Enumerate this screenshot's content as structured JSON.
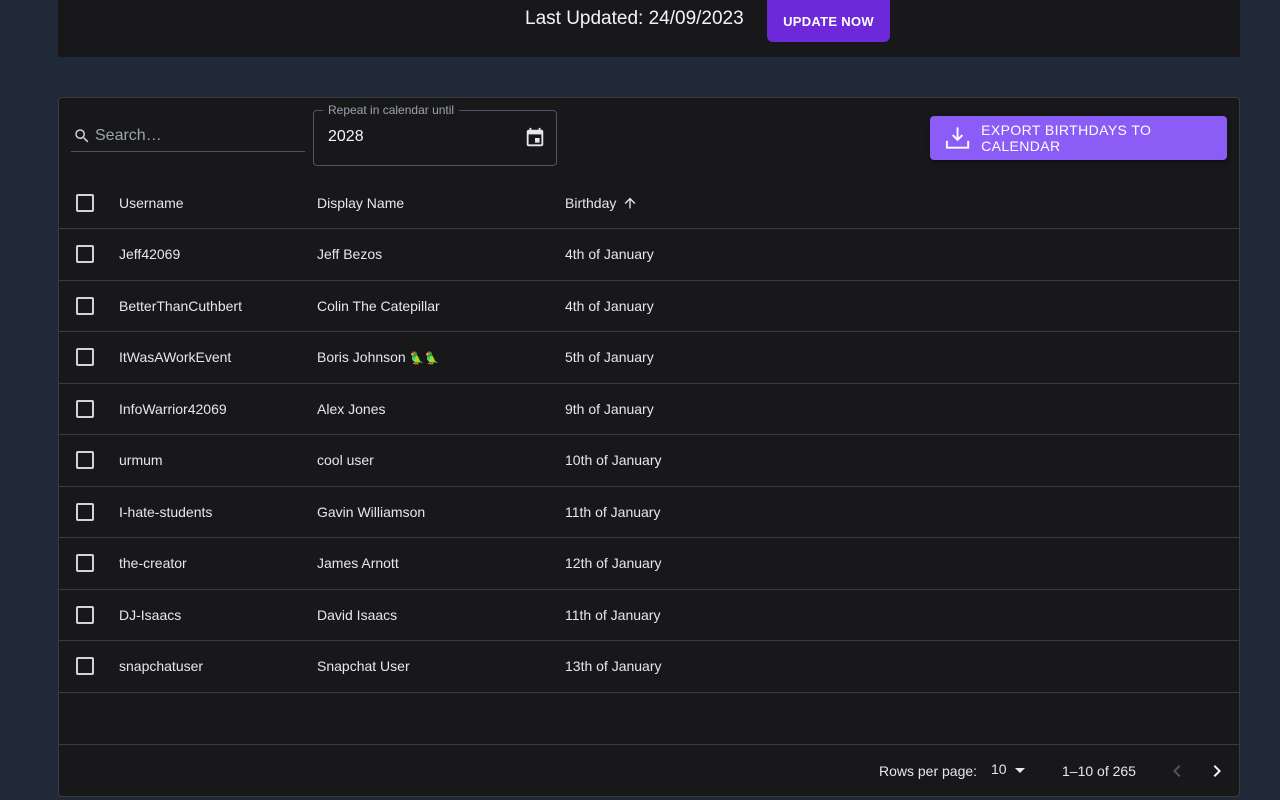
{
  "header": {
    "last_updated": "Last Updated: 24/09/2023",
    "update_button": "UPDATE NOW"
  },
  "toolbar": {
    "search_placeholder": "Search…",
    "repeat_label": "Repeat in calendar until",
    "repeat_value": "2028",
    "export_button": "EXPORT BIRTHDAYS TO CALENDAR"
  },
  "table": {
    "columns": [
      "Username",
      "Display Name",
      "Birthday"
    ],
    "sort": {
      "column": "Birthday",
      "direction": "ascending"
    },
    "rows": [
      {
        "username": "Jeff42069",
        "display_name": "Jeff Bezos",
        "birthday": "4th of January"
      },
      {
        "username": "BetterThanCuthbert",
        "display_name": "Colin The Catepillar",
        "birthday": "4th of January"
      },
      {
        "username": "ItWasAWorkEvent",
        "display_name": "Boris Johnson",
        "emoji": "🦜🦜",
        "birthday": "5th of January"
      },
      {
        "username": "InfoWarrior42069",
        "display_name": "Alex Jones",
        "birthday": "9th of January"
      },
      {
        "username": "urmum",
        "display_name": "cool user",
        "birthday": "10th of January"
      },
      {
        "username": "I-hate-students",
        "display_name": "Gavin Williamson",
        "birthday": "11th of January"
      },
      {
        "username": "the-creator",
        "display_name": "James Arnott",
        "birthday": "12th of January"
      },
      {
        "username": "DJ-Isaacs",
        "display_name": "David Isaacs",
        "birthday": "11th of January"
      },
      {
        "username": "snapchatuser",
        "display_name": "Snapchat User",
        "birthday": "13th of January"
      }
    ]
  },
  "pagination": {
    "rows_per_page_label": "Rows per page:",
    "rows_per_page": "10",
    "range": "1–10 of 265"
  },
  "colors": {
    "background": "#1f2937",
    "panel": "#18181b",
    "update_button": "#6d28d9",
    "export_button": "#8b5cf6"
  },
  "icons": [
    "search-icon",
    "calendar-icon",
    "download-icon",
    "arrow-up-icon",
    "chevron-left-icon",
    "chevron-right-icon",
    "caret-down-icon"
  ]
}
